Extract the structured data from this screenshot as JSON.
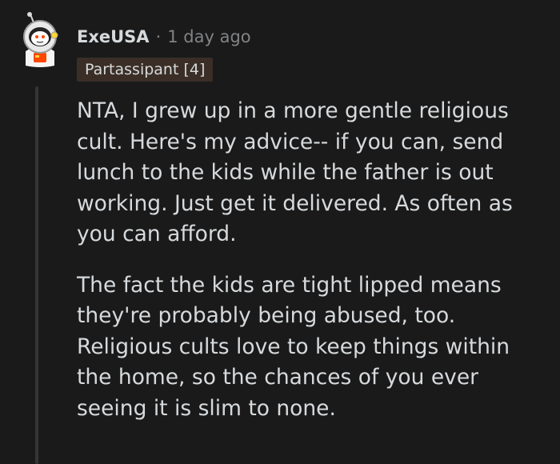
{
  "comment": {
    "author": "ExeUSA",
    "separator": "·",
    "timestamp": "1 day ago",
    "flair": "Partassipant [4]",
    "avatar_icon": "astronaut-avatar-icon",
    "colors": {
      "background": "#1a1a1b",
      "text": "#d7dadc",
      "muted": "#818384",
      "flair_bg": "#3a2e26",
      "thread_line": "#343536"
    },
    "paragraphs": [
      "NTA, I grew up in a more gentle religious cult. Here's my advice-- if you can, send lunch to the kids while the father is out working. Just get it delivered. As often as you can afford.",
      "The fact the kids are tight lipped means they're probably being abused, too. Religious cults love to keep things within the home, so the chances of you ever seeing it is slim to none."
    ]
  }
}
